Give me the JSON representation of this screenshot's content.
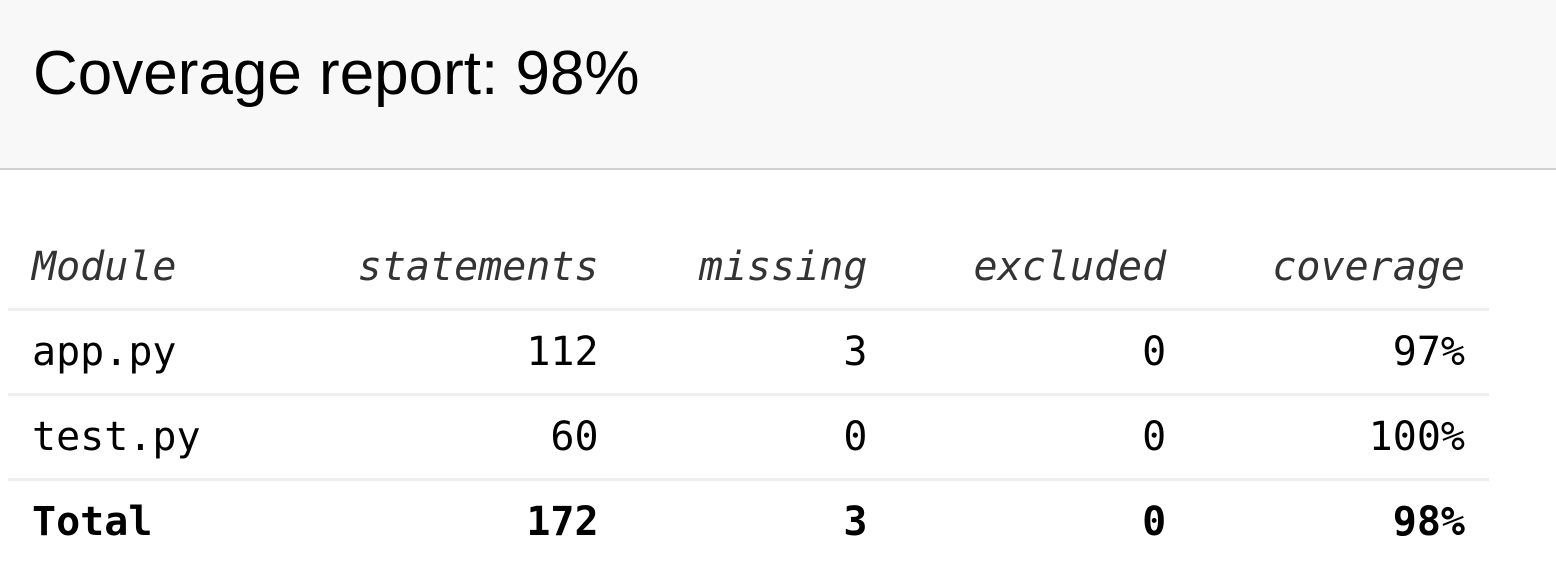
{
  "header": {
    "title": "Coverage report: 98%"
  },
  "table": {
    "columns": [
      "Module",
      "statements",
      "missing",
      "excluded",
      "coverage"
    ],
    "rows": [
      {
        "module": "app.py",
        "statements": "112",
        "missing": "3",
        "excluded": "0",
        "coverage": "97%"
      },
      {
        "module": "test.py",
        "statements": "60",
        "missing": "0",
        "excluded": "0",
        "coverage": "100%"
      }
    ],
    "total": {
      "module": "Total",
      "statements": "172",
      "missing": "3",
      "excluded": "0",
      "coverage": "98%"
    }
  },
  "colors": {
    "header_background": "#f8f8f8",
    "header_border": "#d0d0d0",
    "row_border": "#eeeeee",
    "header_text": "#333333"
  }
}
